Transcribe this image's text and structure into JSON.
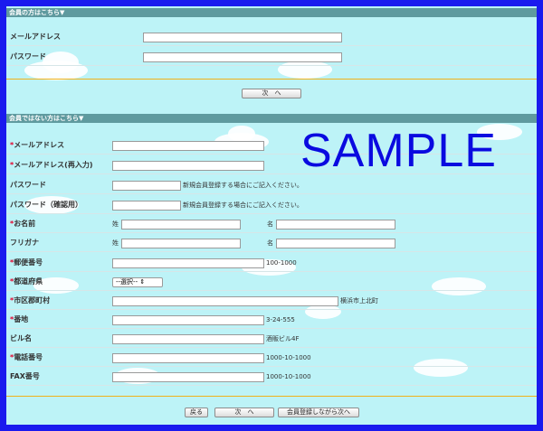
{
  "members": {
    "header": "会員の方はこちら▼",
    "email_label": "メールアドレス",
    "password_label": "パスワード",
    "next_button": "次　へ"
  },
  "guests": {
    "header": "会員ではない方はこちら▼",
    "required_mark": "*",
    "email_label": "メールアドレス",
    "email_confirm_label": "メールアドレス(再入力)",
    "password_label": "パスワード",
    "password_confirm_label": "パスワード（確認用）",
    "password_note": "新規会員登録する場合にご記入ください。",
    "password_confirm_note": "新規会員登録する場合にご記入ください。",
    "name_label": "お名前",
    "last_name_prefix": "姓",
    "first_name_prefix": "名",
    "kana_label": "フリガナ",
    "kana_last_prefix": "姓",
    "kana_first_prefix": "名",
    "postal_label": "郵便番号",
    "postal_example": "100-1000",
    "prefecture_label": "都道府県",
    "prefecture_selected": "--選択--",
    "city_label": "市区郡町村",
    "city_example": "横浜市上北町",
    "address_label": "番地",
    "address_example": "3-24-555",
    "building_label": "ビル名",
    "building_example": "酒販ビル4F",
    "phone_label": "電話番号",
    "phone_example": "1000-10-1000",
    "fax_label": "FAX番号",
    "fax_example": "1000-10-1000",
    "back_button": "戻る",
    "next_button": "次　へ",
    "register_button": "会員登録しながら次へ"
  },
  "watermark": "SAMPLE",
  "colors": {
    "border": "#1a1aee",
    "background": "#bdf3f7",
    "header": "#5f9a9f",
    "required": "#e4002b",
    "divider": "#f0b21a"
  }
}
